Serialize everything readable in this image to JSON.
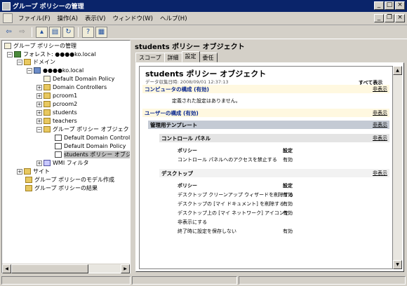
{
  "window": {
    "title": "グループ ポリシーの管理"
  },
  "menu": [
    "ファイル(F)",
    "操作(A)",
    "表示(V)",
    "ウィンドウ(W)",
    "ヘルプ(H)"
  ],
  "tree": {
    "root": "グループ ポリシーの管理",
    "forest": "フォレスト: ●●●●ko.local",
    "domains": "ドメイン",
    "domain": "●●●●ko.local",
    "items": [
      "Default Domain Policy",
      "Domain Controllers",
      "pcroom1",
      "pcroom2",
      "students",
      "teachers",
      "グループ ポリシー オブジェクト"
    ],
    "gpo_items": [
      "Default Domain Controll",
      "Default Domain Policy",
      "students ポリシー オブジェ"
    ],
    "wmi": "WMI フィルタ",
    "site": "サイト",
    "modeling": "グループ ポリシーのモデル作成",
    "results": "グループ ポリシーの結果"
  },
  "right": {
    "title": "students ポリシー オブジェクト",
    "tabs": [
      "スコープ",
      "詳細",
      "設定",
      "委任"
    ],
    "report": {
      "title": "students ポリシー オブジェクト",
      "date": "データ収集日時: 2008/09/01 12:37:13",
      "show_all": "すべて表示",
      "computer_config": "コンピュータの構成 (有効)",
      "hide": "非表示",
      "no_settings": "定義された設定はありません。",
      "user_config": "ユーザーの構成 (有効)",
      "admin_templates": "管理用テンプレート",
      "control_panel": "コントロール パネル",
      "policy_header": "ポリシー",
      "setting_header": "設定",
      "cp_rows": [
        {
          "policy": "コントロール パネルへのアクセスを禁止する",
          "setting": "有効"
        }
      ],
      "desktop": "デスクトップ",
      "desktop_rows": [
        {
          "policy": "デスクトップ クリーンアップ ウィザードを削除する",
          "setting": "有効"
        },
        {
          "policy": "デスクトップの [マイ ドキュメント] を削除する",
          "setting": "有効"
        },
        {
          "policy": "デスクトップ上の [マイ ネットワーク] アイコンを",
          "setting": "有効"
        },
        {
          "policy": "非表示にする",
          "setting": ""
        },
        {
          "policy": "終了時に設定を保存しない",
          "setting": "有効"
        }
      ]
    }
  }
}
